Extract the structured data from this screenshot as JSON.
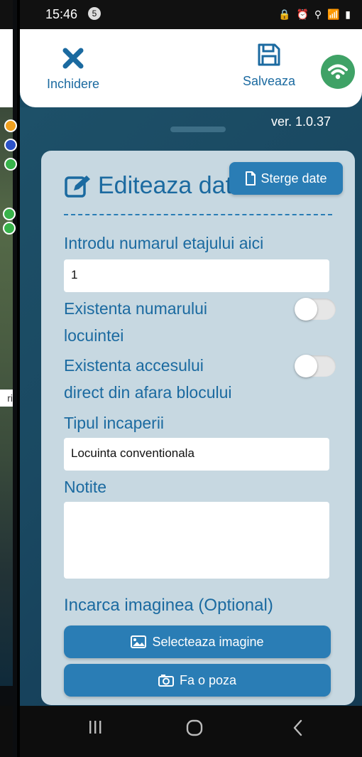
{
  "status_bar": {
    "time": "15:46",
    "notification_count": "5",
    "icons": "🔒 ⏰ ⚲ 📶 ▮"
  },
  "toolbar": {
    "close_label": "Inchidere",
    "save_label": "Salveaza"
  },
  "map_strip": {
    "label": "ri"
  },
  "panel": {
    "version": "ver. 1.0.37"
  },
  "form": {
    "title": "Editeaza date",
    "clear_button": "Sterge date",
    "floor_label": "Introdu numarul etajului aici",
    "floor_value": "1",
    "toggle_house_number_label_1": "Existenta numarului",
    "toggle_house_number_label_2": "locuintei",
    "toggle_direct_access_label_1": "Existenta accesului",
    "toggle_direct_access_label_2": "direct din afara blocului",
    "room_type_label": "Tipul incaperii",
    "room_type_value": "Locuinta conventionala",
    "notes_label": "Notite",
    "notes_value": "",
    "upload_label": "Incarca imaginea (Optional)",
    "select_image_button": "Selecteaza imagine",
    "take_photo_button": "Fa o poza"
  },
  "colors": {
    "accent": "#2a7db5",
    "label_blue": "#1b6aa0",
    "wifi_green": "#3fa266",
    "card_bg": "#c7d8e1"
  }
}
